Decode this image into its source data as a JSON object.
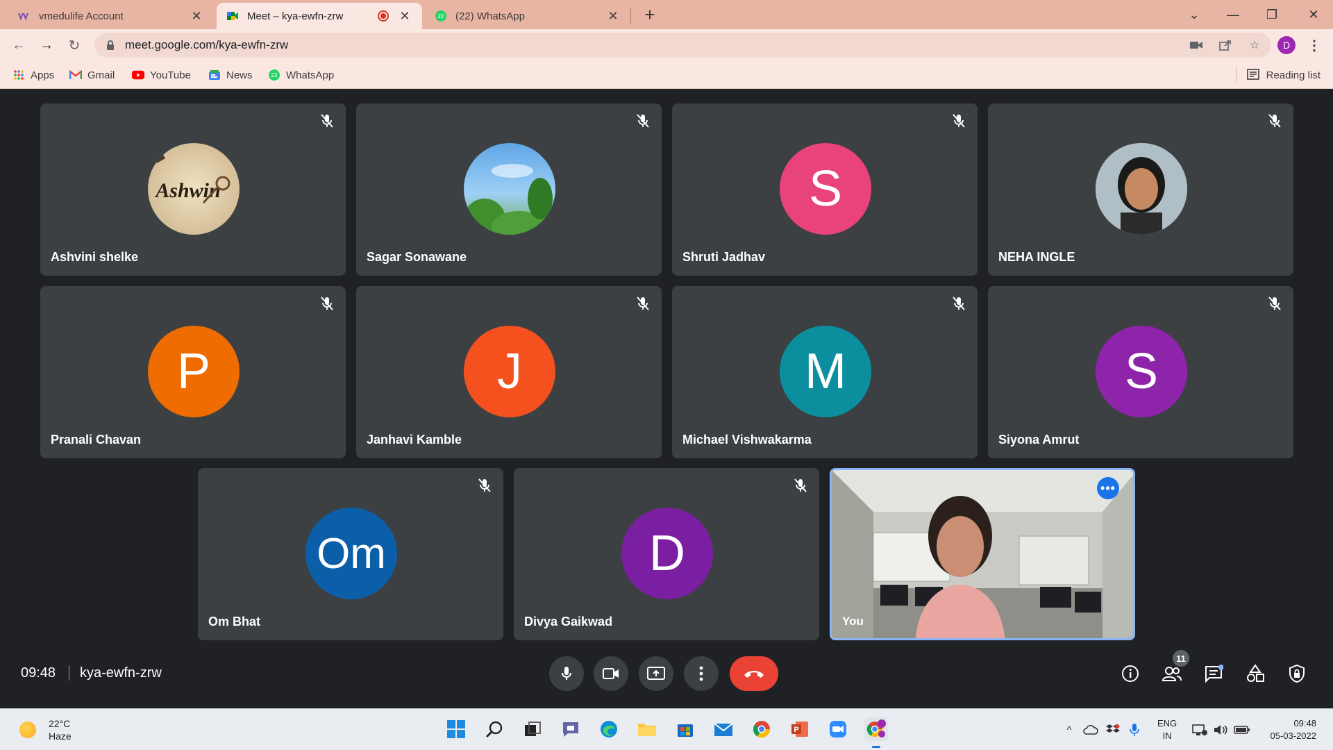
{
  "browser": {
    "tabs": [
      {
        "title": "vmedulife Account",
        "favicon": "vmedulife-icon",
        "active": false
      },
      {
        "title": "Meet – kya-ewfn-zrw",
        "favicon": "google-meet-icon",
        "active": true,
        "recording": true
      },
      {
        "title": "(22) WhatsApp",
        "favicon": "whatsapp-icon",
        "badge": "22",
        "active": false
      }
    ],
    "address": "meet.google.com/kya-ewfn-zrw",
    "profile_initial": "D",
    "bookmarks": [
      {
        "label": "Apps",
        "icon": "apps-grid-icon"
      },
      {
        "label": "Gmail",
        "icon": "gmail-icon"
      },
      {
        "label": "YouTube",
        "icon": "youtube-icon"
      },
      {
        "label": "News",
        "icon": "news-icon"
      },
      {
        "label": "WhatsApp",
        "icon": "whatsapp-icon",
        "badge": "22"
      }
    ],
    "reading_list": "Reading list"
  },
  "meet": {
    "participants": [
      {
        "name": "Ashvini shelke",
        "avatar": "photo-key-art",
        "muted": true
      },
      {
        "name": "Sagar Sonawane",
        "avatar": "photo-sky-plants",
        "muted": true
      },
      {
        "name": "Shruti Jadhav",
        "initial": "S",
        "color": "#e8437a",
        "muted": true
      },
      {
        "name": "NEHA INGLE",
        "avatar": "photo-person",
        "muted": true
      },
      {
        "name": "Pranali Chavan",
        "initial": "P",
        "color": "#ef6c00",
        "muted": true
      },
      {
        "name": "Janhavi Kamble",
        "initial": "J",
        "color": "#f4511e",
        "muted": true
      },
      {
        "name": "Michael Vishwakarma",
        "initial": "M",
        "color": "#0b8f9f",
        "muted": true
      },
      {
        "name": "Siyona Amrut",
        "initial": "S",
        "color": "#8e24aa",
        "muted": true
      },
      {
        "name": "Om Bhat",
        "initial": "Om",
        "color": "#0b5fa8",
        "muted": true
      },
      {
        "name": "Divya Gaikwad",
        "initial": "D",
        "color": "#7b1fa2",
        "muted": true
      }
    ],
    "self": {
      "label": "You"
    },
    "time": "09:48",
    "meeting_code": "kya-ewfn-zrw",
    "people_count": "11"
  },
  "taskbar": {
    "weather_temp": "22°C",
    "weather_desc": "Haze",
    "lang_top": "ENG",
    "lang_bottom": "IN",
    "time": "09:48",
    "date": "05-03-2022"
  }
}
